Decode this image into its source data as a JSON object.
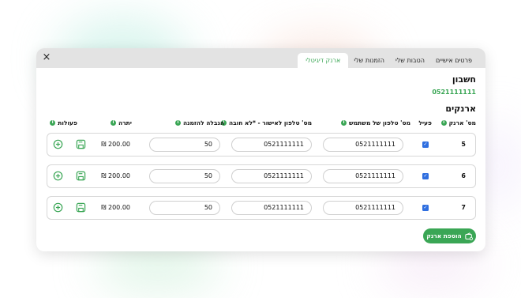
{
  "tabs": [
    "פרטים אישיים",
    "הטבות שלי",
    "הזמנות שלי",
    "ארנק דיגיטלי"
  ],
  "close_label": "×",
  "account_title": "חשבון",
  "account_number": "0521111111",
  "wallets_title": "ארנקים",
  "columns": {
    "wallet_num": "מס' ארנק",
    "active": "פעיל",
    "partner_phone": "מס' טלפון של משתמש",
    "approval_phone": "מס' טלפון לאישור - *לא חובה",
    "order_limit": "הגבלה להזמנה",
    "balance": "יתרה",
    "actions": "פעולות"
  },
  "info_glyph": "i",
  "rows": [
    {
      "num": "5",
      "active": true,
      "user_phone": "0521111111",
      "approval_phone": "0521111111",
      "limit": "50",
      "balance": "₪ 200.00"
    },
    {
      "num": "6",
      "active": true,
      "user_phone": "0521111111",
      "approval_phone": "0521111111",
      "limit": "50",
      "balance": "₪ 200.00"
    },
    {
      "num": "7",
      "active": true,
      "user_phone": "0521111111",
      "approval_phone": "0521111111",
      "limit": "50",
      "balance": "₪ 200.00"
    }
  ],
  "add_wallet_label": "הוספת ארנק",
  "colors": {
    "accent": "#3aa655",
    "checkbox": "#2f6fe0"
  },
  "icons": {
    "close": "close-icon",
    "info": "info-icon",
    "add": "plus-circle-icon",
    "save": "save-icon",
    "wallet": "wallet-add-icon"
  }
}
